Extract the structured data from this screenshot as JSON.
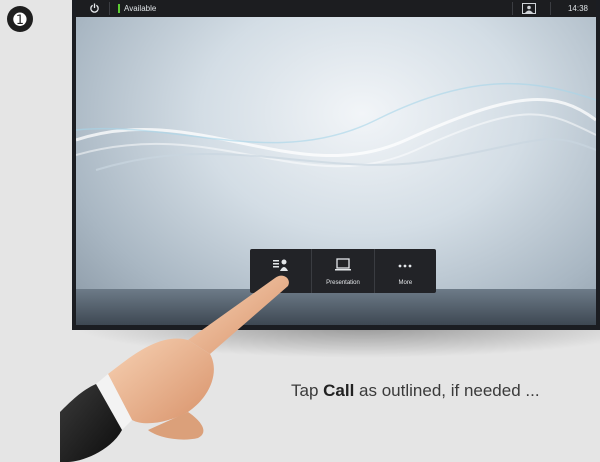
{
  "step": {
    "number": "➊"
  },
  "statusbar": {
    "availability": "Available",
    "time": "14:38"
  },
  "tray": {
    "buttons": [
      {
        "label": "",
        "icon": "call-icon"
      },
      {
        "label": "Presentation",
        "icon": "presentation-icon"
      },
      {
        "label": "More",
        "icon": "more-icon"
      }
    ]
  },
  "instruction": {
    "before": "Tap ",
    "bold": "Call",
    "after": " as outlined, if needed ..."
  },
  "colors": {
    "available": "#5dcc33",
    "tray": "#222327",
    "background": "#e5e5e5"
  }
}
